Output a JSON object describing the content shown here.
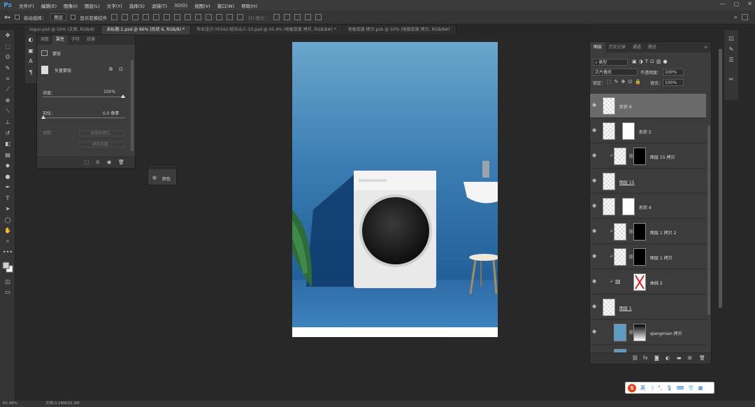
{
  "app": {
    "logo": "Ps"
  },
  "menu": [
    "文件(F)",
    "编辑(E)",
    "图像(I)",
    "图层(L)",
    "文字(Y)",
    "选择(S)",
    "滤镜(T)",
    "3D(D)",
    "视图(V)",
    "窗口(W)",
    "帮助(H)"
  ],
  "window_controls": [
    "—",
    "▢",
    "✕"
  ],
  "options": {
    "auto_select_label": "自动选择：",
    "auto_select_value": "图层",
    "show_transform_label": "显示变换控件",
    "mode3d_label": "3D 模式："
  },
  "tabs": [
    "loguo.psd @ 50% (文案, RGB/8)",
    "未标题-1.psd @ 66% (形状 6, RGB/8) *",
    "毕业设计-Y0342-给中山人-10.psd @ 45.4% (地板厚度 拷贝, RGB/8#) *",
    "地板厚度 拷贝.psb @ 50% (地板厚度 拷贝, RGB/8#)"
  ],
  "properties": {
    "tabs": [
      "调整",
      "属性",
      "字符",
      "段落"
    ],
    "section_label": "蒙版",
    "mask_type": "矢量蒙版",
    "density_label": "浓度：",
    "density_value": "100%",
    "feather_label": "羽化：",
    "feather_value": "0.0 像素",
    "refine_label": "调整：",
    "select_and_mask_btn": "选择并遮住...",
    "color_range_btn": "颜色范围..."
  },
  "color_panel": {
    "label": "颜色"
  },
  "layers": {
    "tabs": [
      "图层",
      "历史记录",
      "通道",
      "路径"
    ],
    "filter_label": "类型",
    "blend_mode": "正片叠底",
    "opacity_label": "不透明度：",
    "opacity_value": "100%",
    "lock_label": "锁定：",
    "fill_label": "填充：",
    "fill_value": "100%",
    "items": [
      {
        "name": "形状 6",
        "selected": true
      },
      {
        "name": "形状 5",
        "selected": false
      },
      {
        "name": "图层 15 拷贝",
        "selected": false
      },
      {
        "name": "图层 15",
        "selected": false
      },
      {
        "name": "形状 4",
        "selected": false
      },
      {
        "name": "图层 1 拷贝 2",
        "selected": false
      },
      {
        "name": "图层 1 拷贝",
        "selected": false
      },
      {
        "name": "曲线 2",
        "selected": false
      },
      {
        "name": "图层 1",
        "selected": false
      },
      {
        "name": "qiangmian 拷贝",
        "selected": false
      }
    ]
  },
  "status": {
    "zoom": "65.98%",
    "doc_info": "文档:3.16M/31.2M"
  },
  "ime": {
    "label": "英"
  },
  "colors": {
    "ps_blue": "#4aa3e8",
    "wall_top": "#5f9ec6",
    "wall_bottom": "#1e5c95",
    "floor": "#2f6fa8"
  }
}
